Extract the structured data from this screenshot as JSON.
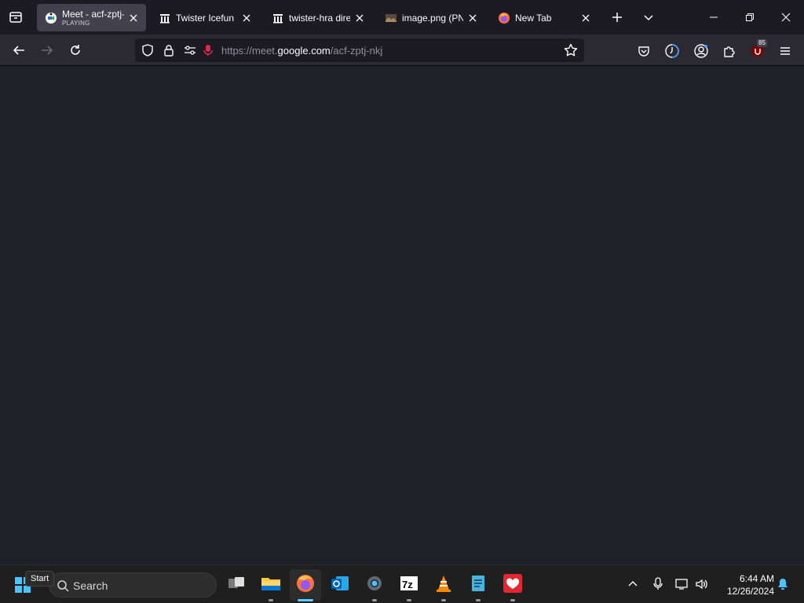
{
  "tabs": [
    {
      "title": "Meet - acf-zptj-",
      "subtitle": "PLAYING",
      "active": true,
      "favicon": "meet-icon"
    },
    {
      "title": "Twister Icefun : A",
      "active": false,
      "favicon": "archive-icon"
    },
    {
      "title": "twister-hra direc",
      "active": false,
      "favicon": "archive-icon"
    },
    {
      "title": "image.png (PNG",
      "active": false,
      "favicon": "image-icon"
    },
    {
      "title": "New Tab",
      "active": false,
      "favicon": "firefox-icon"
    }
  ],
  "address_bar": {
    "prefix": "https://meet.",
    "host": "google.com",
    "path": "/acf-zptj-nkj"
  },
  "extensions": {
    "badge_count": "85"
  },
  "taskbar": {
    "tooltip": "Start",
    "search_label": "Search",
    "time": "6:44 AM",
    "date": "12/26/2024"
  },
  "colors": {
    "accent": "#60cdff",
    "page_bg": "#202028",
    "toolbar_bg": "#2b2a33"
  }
}
